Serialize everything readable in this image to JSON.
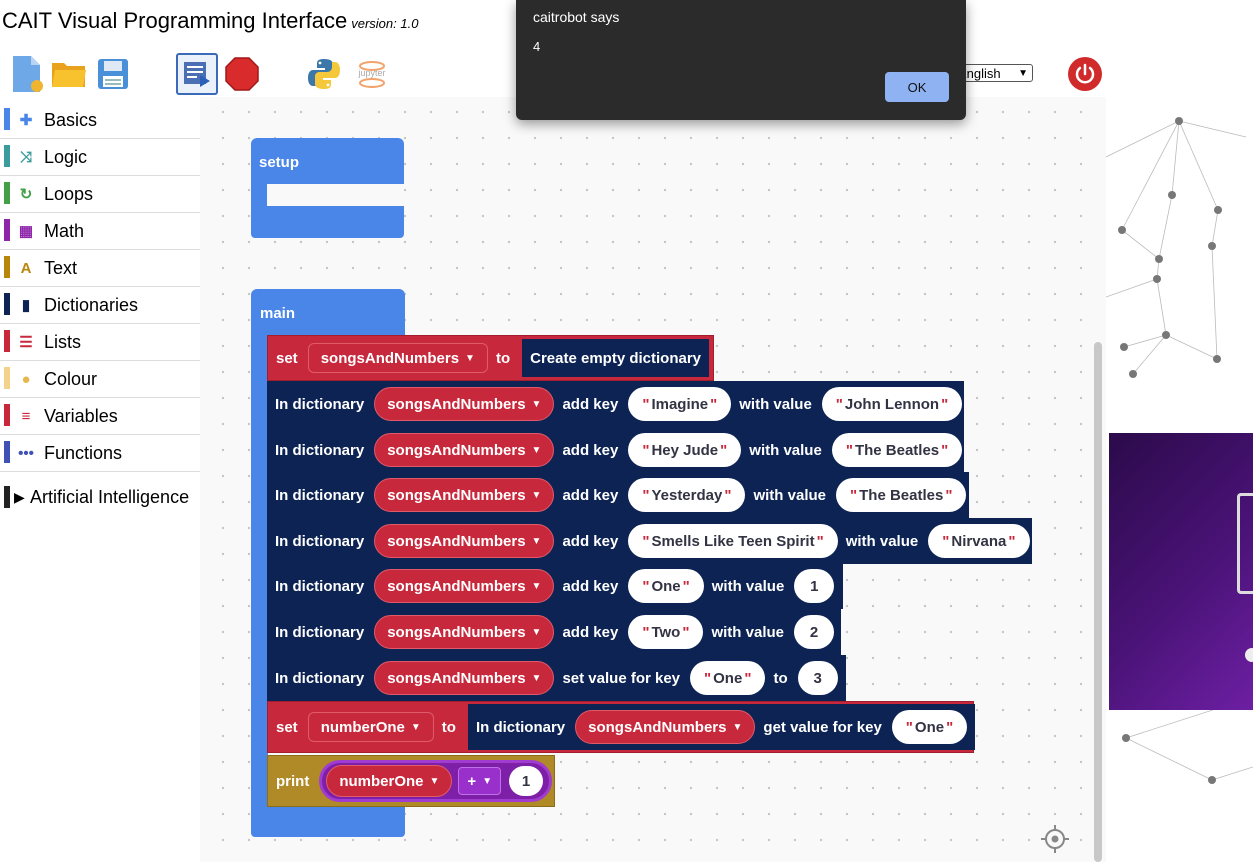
{
  "header": {
    "title": "CAIT Visual Programming Interface",
    "version": "version: 1.0",
    "language_selected": "English"
  },
  "toolbar_icons": [
    "new-file-icon",
    "open-folder-icon",
    "save-icon",
    "run-icon",
    "stop-icon",
    "python-icon",
    "jupyter-icon",
    "power-icon"
  ],
  "toolbar": {
    "jupyter_label": "jupyter"
  },
  "sidebar": {
    "categories": [
      {
        "label": "Basics",
        "color": "#4a86e8"
      },
      {
        "label": "Logic",
        "color": "#3a9c9c"
      },
      {
        "label": "Loops",
        "color": "#43a047"
      },
      {
        "label": "Math",
        "color": "#8e24aa"
      },
      {
        "label": "Text",
        "color": "#b8860b"
      },
      {
        "label": "Dictionaries",
        "color": "#0c2354"
      },
      {
        "label": "Lists",
        "color": "#c8283c"
      },
      {
        "label": "Colour",
        "color": "#f3d38c"
      },
      {
        "label": "Variables",
        "color": "#c8283c"
      },
      {
        "label": "Functions",
        "color": "#3f51b5"
      }
    ],
    "ai_label": "Artificial Intelligence"
  },
  "blocks": {
    "setup_label": "setup",
    "main_label": "main",
    "set_label": "set",
    "to_label": "to",
    "create_dict_label": "Create empty dictionary",
    "in_dict_label": "In dictionary",
    "add_key_label": "add key",
    "with_value_label": "with value",
    "set_value_for_key_label": "set value for key",
    "get_value_for_key_label": "get value for key",
    "print_label": "print",
    "dict_var": "songsAndNumbers",
    "num_var": "numberOne",
    "entries": [
      {
        "key": "Imagine",
        "value": "John Lennon",
        "value_is_string": true
      },
      {
        "key": "Hey Jude",
        "value": "The Beatles",
        "value_is_string": true
      },
      {
        "key": "Yesterday",
        "value": "The Beatles",
        "value_is_string": true
      },
      {
        "key": "Smells Like Teen Spirit",
        "value": "Nirvana",
        "value_is_string": true
      },
      {
        "key": "One",
        "value": "1",
        "value_is_string": false
      },
      {
        "key": "Two",
        "value": "2",
        "value_is_string": false
      }
    ],
    "set_value_key": "One",
    "set_value_to": "3",
    "get_key": "One",
    "operator": "+",
    "addend": "1"
  },
  "dialog": {
    "title": "caitrobot says",
    "message": "4",
    "ok_label": "OK"
  }
}
